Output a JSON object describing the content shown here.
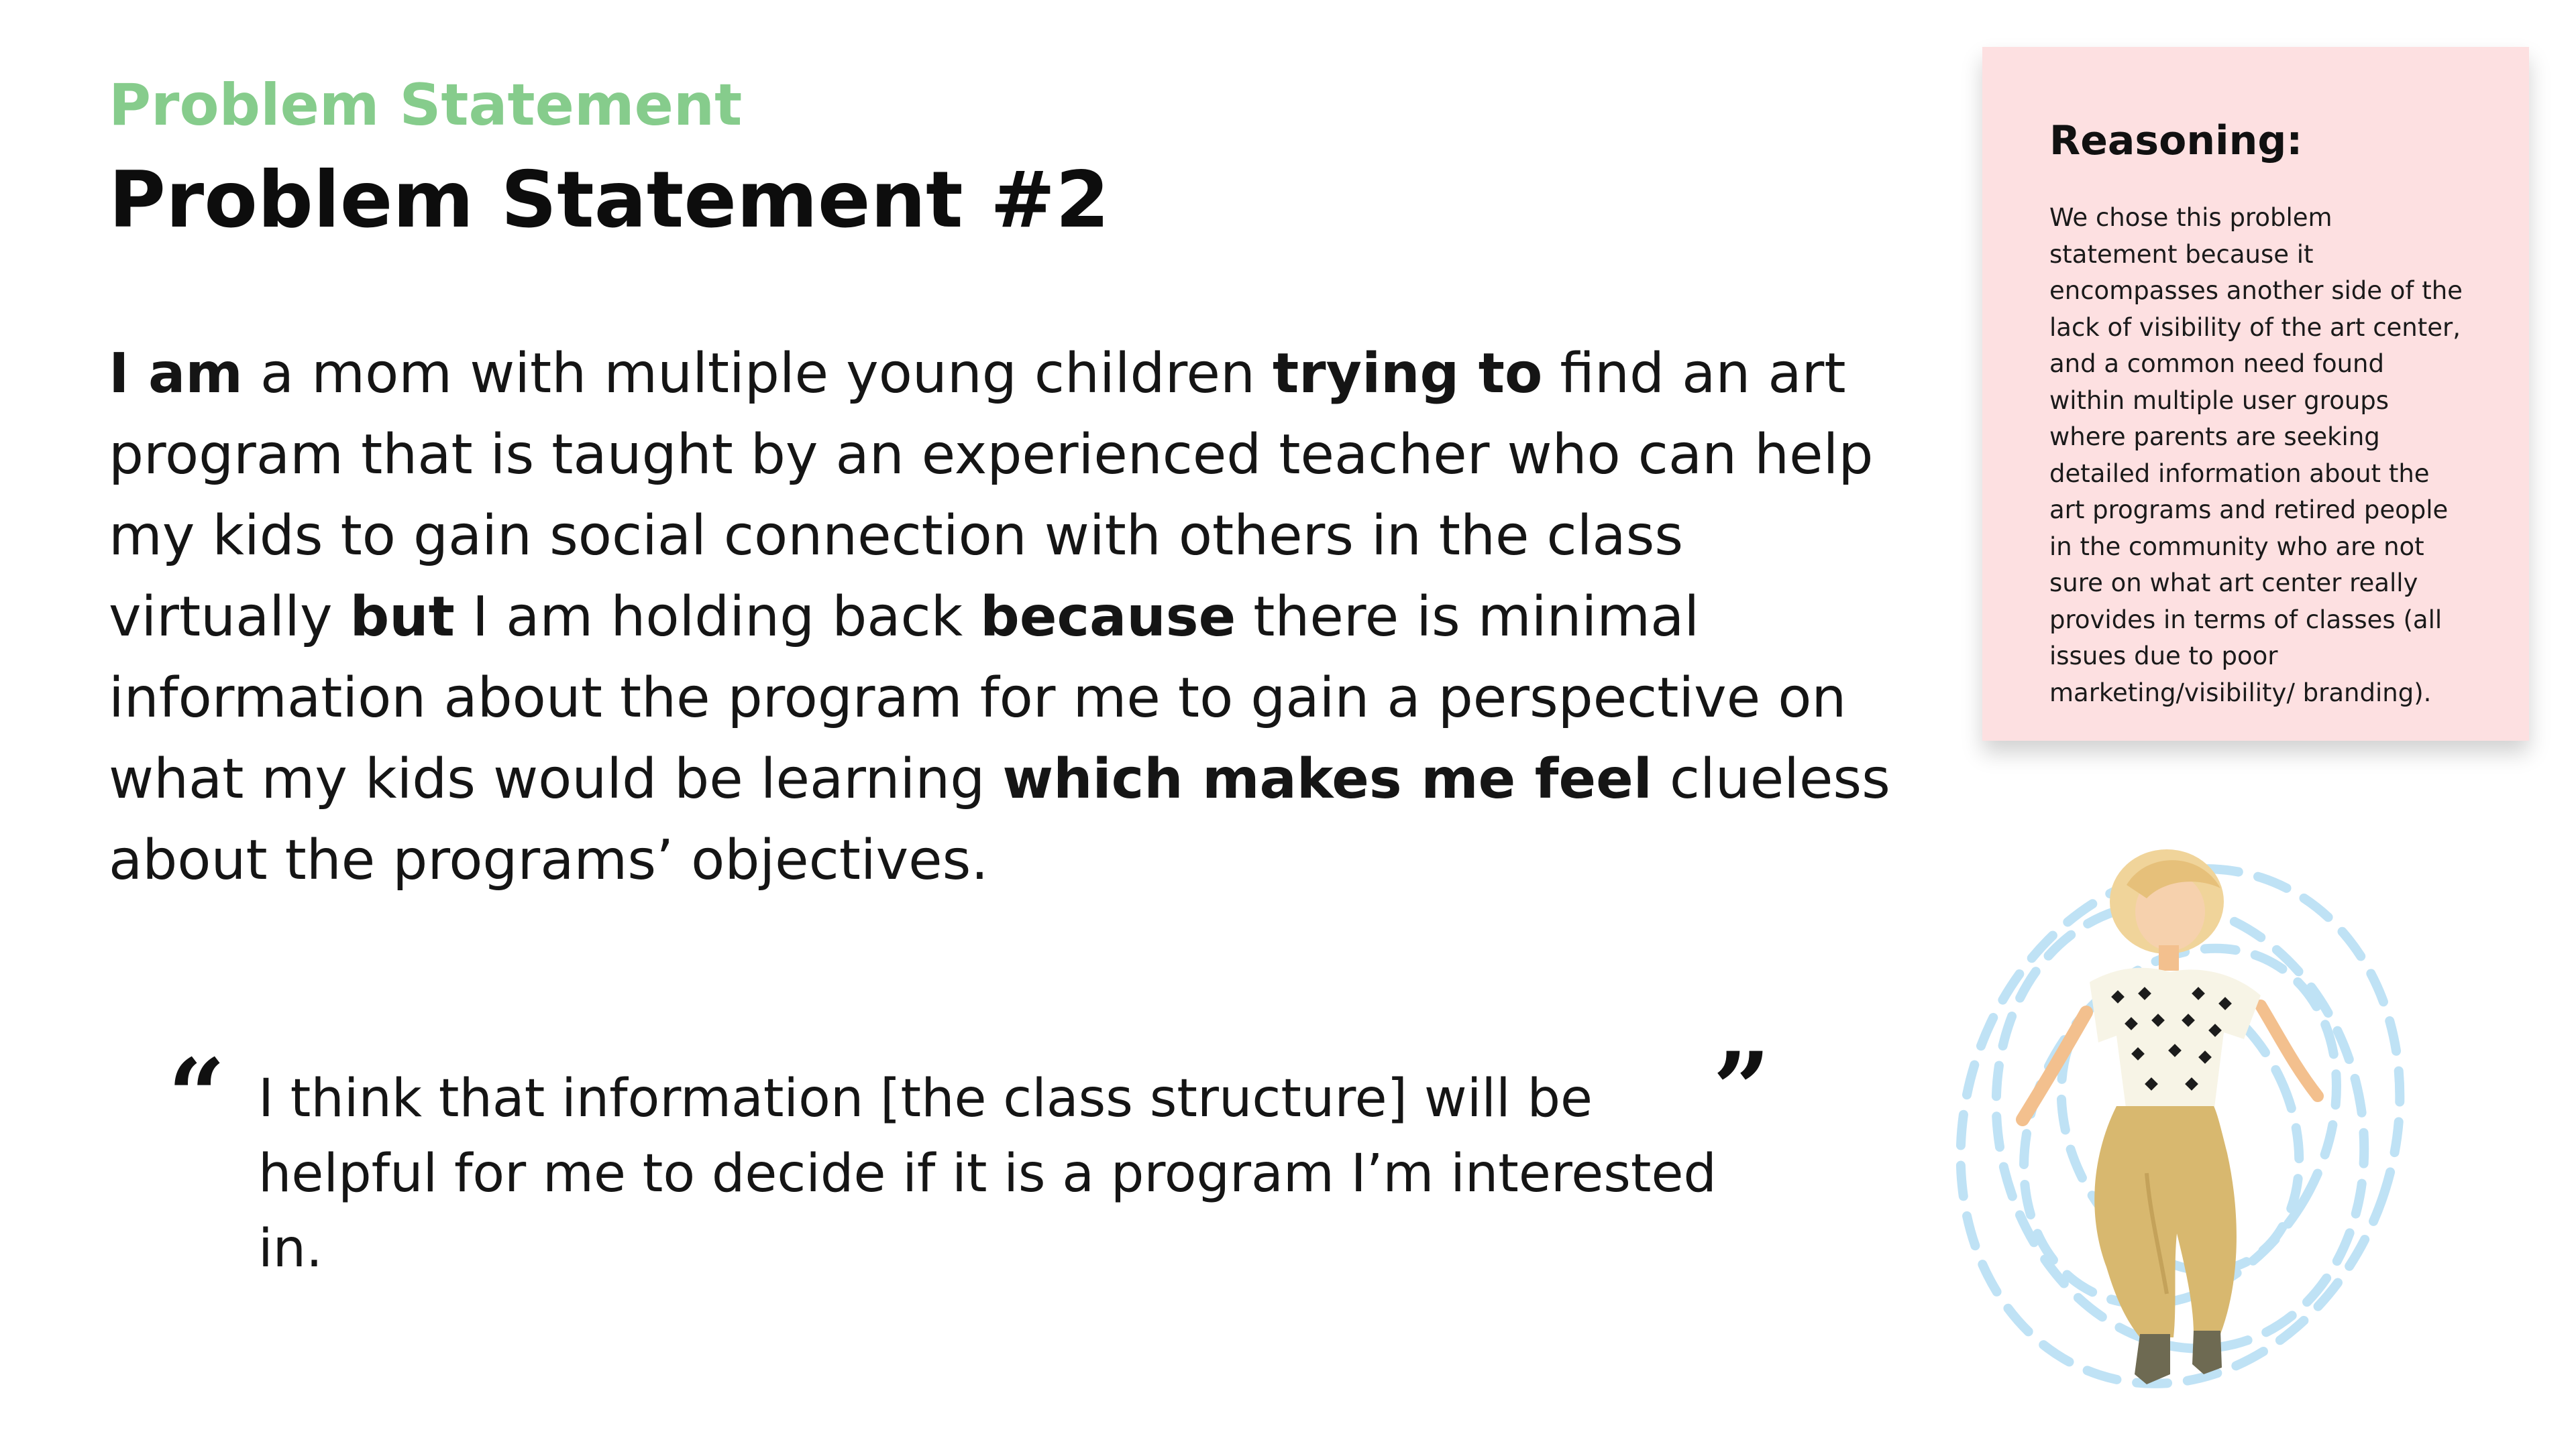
{
  "header": {
    "eyebrow": "Problem Statement",
    "title": "Problem Statement #2"
  },
  "statement": {
    "segments": [
      {
        "text": "I am",
        "bold": true
      },
      {
        "text": " a mom with multiple young children ",
        "bold": false
      },
      {
        "text": "trying to",
        "bold": true
      },
      {
        "text": " find an art program that is taught by an experienced teacher who can help my kids to gain social connection with others in the class virtually ",
        "bold": false
      },
      {
        "text": "but",
        "bold": true
      },
      {
        "text": " I am holding back ",
        "bold": false
      },
      {
        "text": "because",
        "bold": true
      },
      {
        "text": " there is minimal information about the program for me to gain a perspective on what my kids would be learning ",
        "bold": false
      },
      {
        "text": "which makes me feel",
        "bold": true
      },
      {
        "text": " clueless about the programs’ objectives.",
        "bold": false
      }
    ]
  },
  "quote": {
    "open_mark": "“",
    "close_mark": "”",
    "text": "I think that information [the class structure] will be helpful for me to decide if it is a program I’m interested in."
  },
  "reasoning": {
    "heading": "Reasoning:",
    "body": "We chose this problem statement because it encompasses another side of the lack of visibility of the art center, and a common need found within multiple user groups where parents are seeking detailed information about the art programs and retired people in the community who are not sure on what art center really provides in terms of classes (all issues due to poor marketing/visibility/ branding)."
  },
  "colors": {
    "eyebrow": "#86cc8c",
    "card_background": "#fde0e1",
    "swirl": "#bfe2f5",
    "pants": "#d8b86f",
    "hair": "#f0d49a",
    "boots": "#6e6a52"
  },
  "illustration": {
    "icon": "woman-dancing-illustration"
  }
}
